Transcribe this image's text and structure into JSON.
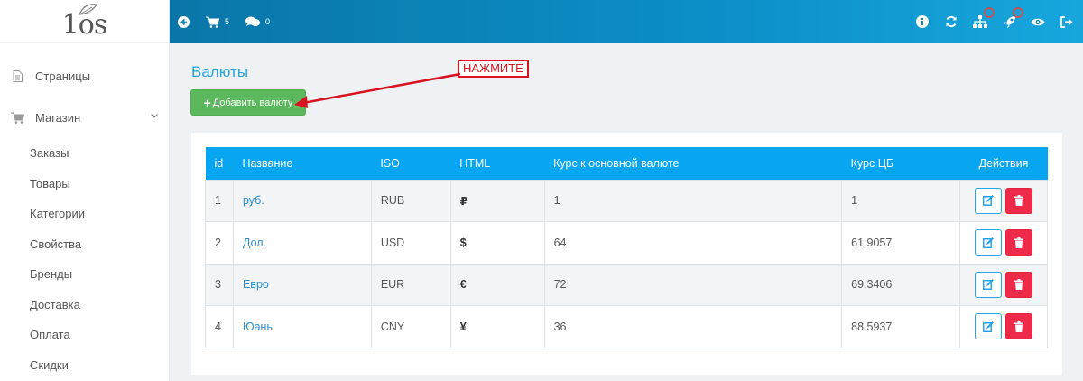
{
  "logo": {
    "text": "1os"
  },
  "sidebar": {
    "items": [
      {
        "label": "Страницы",
        "icon": "file-icon"
      },
      {
        "label": "Магазин",
        "icon": "cart-icon",
        "expanded": true
      }
    ],
    "sub_items": [
      "Заказы",
      "Товары",
      "Категории",
      "Свойства",
      "Бренды",
      "Доставка",
      "Оплата",
      "Скидки"
    ]
  },
  "topbar": {
    "cart_count": "5",
    "messages_count": "0",
    "right_icons": [
      "info-icon",
      "refresh-icon",
      "sitemap-icon",
      "rocket-icon",
      "eye-icon",
      "logout-icon"
    ]
  },
  "page": {
    "title": "Валюты",
    "add_button": "Добавить валюту",
    "callout": "НАЖМИТЕ"
  },
  "table": {
    "headers": [
      "id",
      "Название",
      "ISO",
      "HTML",
      "Курс к основной валюте",
      "Курс ЦБ",
      "Действия"
    ],
    "rows": [
      {
        "id": "1",
        "name": "руб.",
        "iso": "RUB",
        "html": "₽",
        "rate": "1",
        "cb": "1"
      },
      {
        "id": "2",
        "name": "Дол.",
        "iso": "USD",
        "html": "$",
        "rate": "64",
        "cb": "61.9057"
      },
      {
        "id": "3",
        "name": "Евро",
        "iso": "EUR",
        "html": "€",
        "rate": "72",
        "cb": "69.3406"
      },
      {
        "id": "4",
        "name": "Юань",
        "iso": "CNY",
        "html": "¥",
        "rate": "36",
        "cb": "88.5937"
      }
    ]
  },
  "colors": {
    "topbar": "#0c8fc8",
    "header_row": "#08a5f0",
    "add_button": "#5cb85c",
    "delete_button": "#ee2a4b",
    "link": "#2a8ecf",
    "callout": "#d8121e"
  }
}
